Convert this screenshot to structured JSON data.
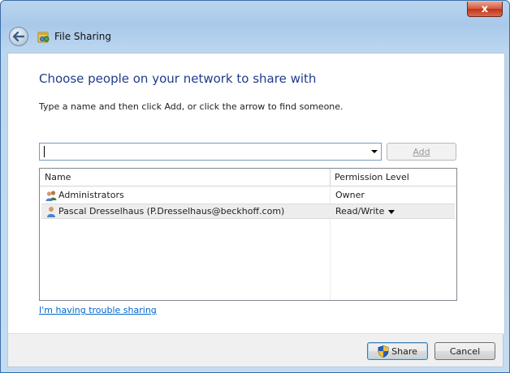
{
  "window": {
    "title": "File Sharing",
    "close_glyph": "x"
  },
  "icons": {
    "back": "back-arrow-icon",
    "title": "file-sharing-icon",
    "group": "user-group-icon",
    "user": "user-icon",
    "shield": "uac-shield-icon"
  },
  "main": {
    "heading": "Choose people on your network to share with",
    "instruction": "Type a name and then click Add, or click the arrow to find someone.",
    "name_input": {
      "value": "",
      "placeholder": ""
    },
    "add_label": "Add"
  },
  "list": {
    "headers": {
      "name": "Name",
      "permission": "Permission Level"
    },
    "rows": [
      {
        "name": "Administrators",
        "permission": "Owner",
        "icon": "user-group-icon"
      },
      {
        "name": "Pascal Dresselhaus (P.Dresselhaus@beckhoff.com)",
        "permission": "Read/Write",
        "icon": "user-icon",
        "selected": true
      }
    ]
  },
  "trouble_link": "I'm having trouble sharing",
  "footer": {
    "share_label": "Share",
    "cancel_label": "Cancel"
  },
  "colors": {
    "heading": "#1e3c8c",
    "link": "#0066cc",
    "frame": "#bcd6ef",
    "close": "#c0331a"
  }
}
